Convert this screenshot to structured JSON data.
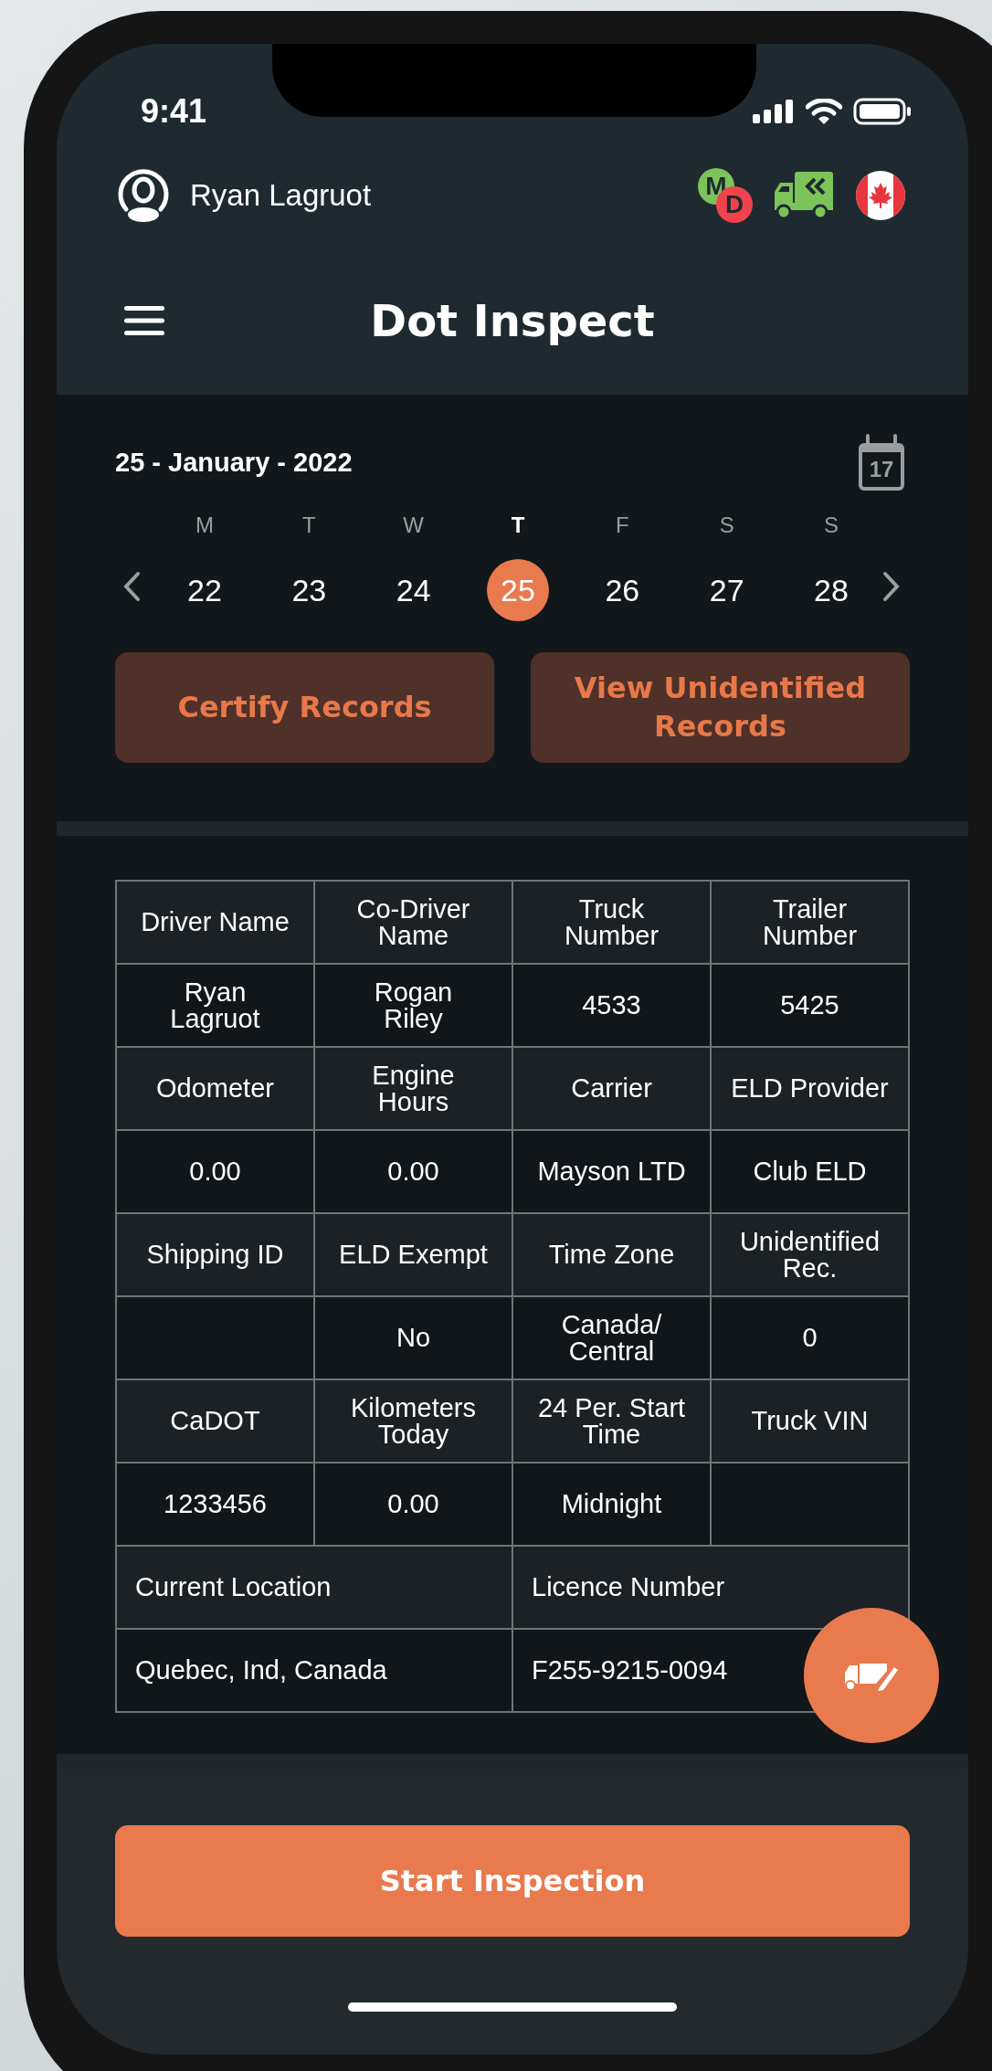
{
  "status_bar": {
    "time": "9:41"
  },
  "header": {
    "user_name": "Ryan Lagruot",
    "mode_badge": {
      "primary": "M",
      "secondary": "D"
    },
    "title": "Dot Inspect"
  },
  "date_picker": {
    "date_label": "25 - January - 2022",
    "calendar_icon_day": "17",
    "days": [
      {
        "weekday": "M",
        "date": "22",
        "selected": false
      },
      {
        "weekday": "T",
        "date": "23",
        "selected": false
      },
      {
        "weekday": "W",
        "date": "24",
        "selected": false
      },
      {
        "weekday": "T",
        "date": "25",
        "selected": true
      },
      {
        "weekday": "F",
        "date": "26",
        "selected": false
      },
      {
        "weekday": "S",
        "date": "27",
        "selected": false
      },
      {
        "weekday": "S",
        "date": "28",
        "selected": false
      }
    ]
  },
  "actions": [
    "Certify Records",
    "View Unidentified\nRecords"
  ],
  "table": {
    "rows": [
      {
        "kind": "label",
        "cells": [
          "Driver Name",
          "Co-Driver\nName",
          "Truck\nNumber",
          "Trailer\nNumber"
        ]
      },
      {
        "kind": "value",
        "cells": [
          "Ryan\nLagruot",
          "Rogan\nRiley",
          "4533",
          "5425"
        ]
      },
      {
        "kind": "label",
        "cells": [
          "Odometer",
          "Engine\nHours",
          "Carrier",
          "ELD Provider"
        ]
      },
      {
        "kind": "value",
        "cells": [
          "0.00",
          "0.00",
          "Mayson LTD",
          "Club ELD"
        ]
      },
      {
        "kind": "label",
        "cells": [
          "Shipping ID",
          "ELD Exempt",
          "Time Zone",
          "Unidentified\nRec."
        ]
      },
      {
        "kind": "value",
        "cells": [
          null,
          "No",
          "Canada/\nCentral",
          "0"
        ]
      },
      {
        "kind": "label",
        "cells": [
          "CaDOT",
          "Kilometers\nToday",
          "24 Per. Start\nTime",
          "Truck VIN"
        ]
      },
      {
        "kind": "value",
        "cells": [
          "1233456",
          "0.00",
          "Midnight",
          null
        ]
      },
      {
        "kind": "label",
        "cells": [
          "Current Location",
          "Licence Number"
        ]
      },
      {
        "kind": "value",
        "cells": [
          "Quebec, Ind, Canada",
          "F255-9215-0094"
        ]
      }
    ]
  },
  "start_button": "Start Inspection"
}
